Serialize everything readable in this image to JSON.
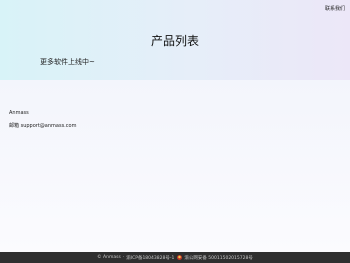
{
  "header": {
    "contact_label": "联系我们"
  },
  "hero": {
    "title": "产品列表",
    "tagline": "更多软件上线中~"
  },
  "company": {
    "name": "Anmass",
    "email_label": "邮箱",
    "email": "support@anmass.com"
  },
  "footer": {
    "copyright": "© Anmass",
    "icp": "渝ICP备18043828号-1",
    "police_icon": "police-badge-icon",
    "police": "渝公网安备 50011502015728号"
  }
}
